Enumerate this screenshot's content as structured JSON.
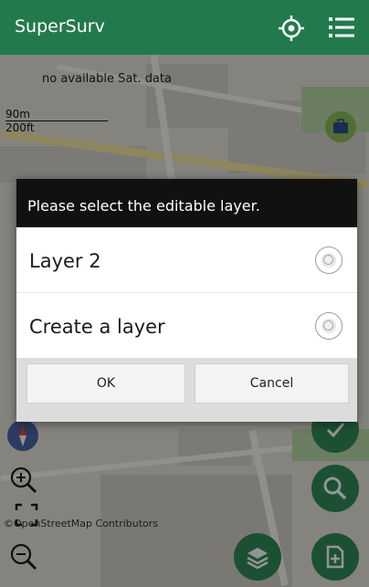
{
  "app": {
    "title": "SuperSurv"
  },
  "map": {
    "sat_status": "no available Sat. data",
    "scale_m": "90m",
    "scale_ft": "200ft",
    "attribution": "©OpenStreetMap Contributors"
  },
  "dialog": {
    "title": "Please select the editable layer.",
    "options": [
      {
        "label": "Layer 2"
      },
      {
        "label": "Create a layer"
      }
    ],
    "ok_label": "OK",
    "cancel_label": "Cancel"
  },
  "colors": {
    "appbar": "#227a4c",
    "fab": "#2f8c57",
    "dialog_header": "#111111"
  },
  "icons": [
    "gps-target-icon",
    "menu-list-icon",
    "briefcase-icon",
    "compass-icon",
    "zoom-in-icon",
    "fullscreen-icon",
    "zoom-out-icon",
    "layers-icon",
    "search-icon",
    "add-file-icon",
    "edit-check-icon"
  ]
}
